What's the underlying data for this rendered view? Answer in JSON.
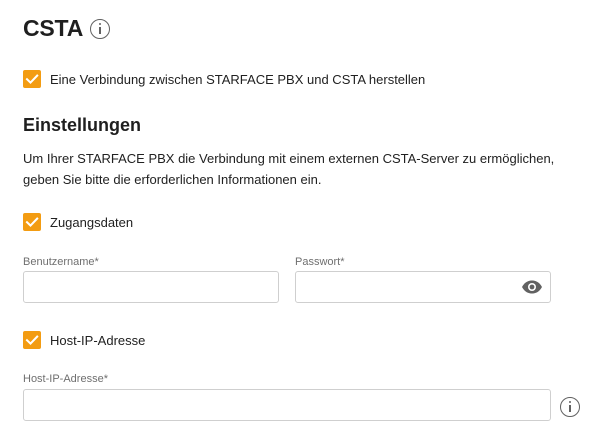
{
  "header": {
    "title": "CSTA",
    "info_icon": "info-icon"
  },
  "main_toggle": {
    "checked": true,
    "label": "Eine Verbindung zwischen STARFACE PBX und CSTA herstellen"
  },
  "settings": {
    "heading": "Einstellungen",
    "description": "Um Ihrer STARFACE PBX die Verbindung mit einem externen CSTA-Server zu ermöglichen, geben Sie bitte die erforderlichen Informationen ein."
  },
  "credentials": {
    "checked": true,
    "label": "Zugangsdaten",
    "username": {
      "label": "Benutzername*",
      "value": "",
      "placeholder": ""
    },
    "password": {
      "label": "Passwort*",
      "value": "",
      "placeholder": "",
      "toggle_icon": "eye-icon"
    }
  },
  "host": {
    "checked": true,
    "label": "Host-IP-Adresse",
    "ip": {
      "label": "Host-IP-Adresse*",
      "value": "",
      "placeholder": "",
      "info_icon": "info-icon"
    }
  },
  "colors": {
    "accent": "#f39c12",
    "text": "#212121",
    "label": "#6f6f6f",
    "border": "#cfcfcf"
  }
}
